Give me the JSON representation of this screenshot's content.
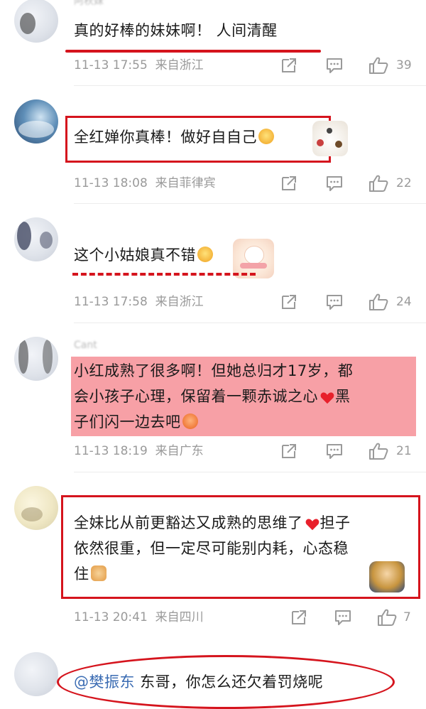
{
  "comments": [
    {
      "username": "阿秋妹",
      "text": "真的好棒的妹妹啊！ 人间清醒",
      "time": "11-13 17:55",
      "location": "来自浙江",
      "likes": "39"
    },
    {
      "username": "",
      "text": "全红婵你真棒！做好自自己",
      "time": "11-13 18:08",
      "location": "来自菲律宾",
      "likes": "22"
    },
    {
      "username": "",
      "text": "这个小姑娘真不错",
      "time": "11-13 17:58",
      "location": "来自浙江",
      "likes": "24"
    },
    {
      "username": "Cant",
      "text_line1": "小红成熟了很多啊！但她总归才17岁，都",
      "text_line2": "会小孩子心理，保留着一颗赤诚之心",
      "text_line2b": "黑",
      "text_line3": "子们闪一边去吧",
      "time": "11-13 18:19",
      "location": "来自广东",
      "likes": "21"
    },
    {
      "username": "",
      "text_line1": "全妹比从前更豁达又成熟的思维了",
      "text_line1b": "担子",
      "text_line2": "依然很重，但一定尽可能别内耗，心态稳",
      "text_line3": "住",
      "time": "11-13 20:41",
      "location": "来自四川",
      "likes": "7"
    },
    {
      "username": "",
      "mention": "@樊振东",
      "text": " 东哥，你怎么还欠着罚烧呢"
    }
  ],
  "colors": {
    "annotation_red": "#d5141d",
    "highlight_pink": "#f7a0a6",
    "mention_blue": "#3b6cb3",
    "meta_gray": "#9a9a9a"
  },
  "icons": [
    "share-icon",
    "comment-icon",
    "like-icon"
  ]
}
